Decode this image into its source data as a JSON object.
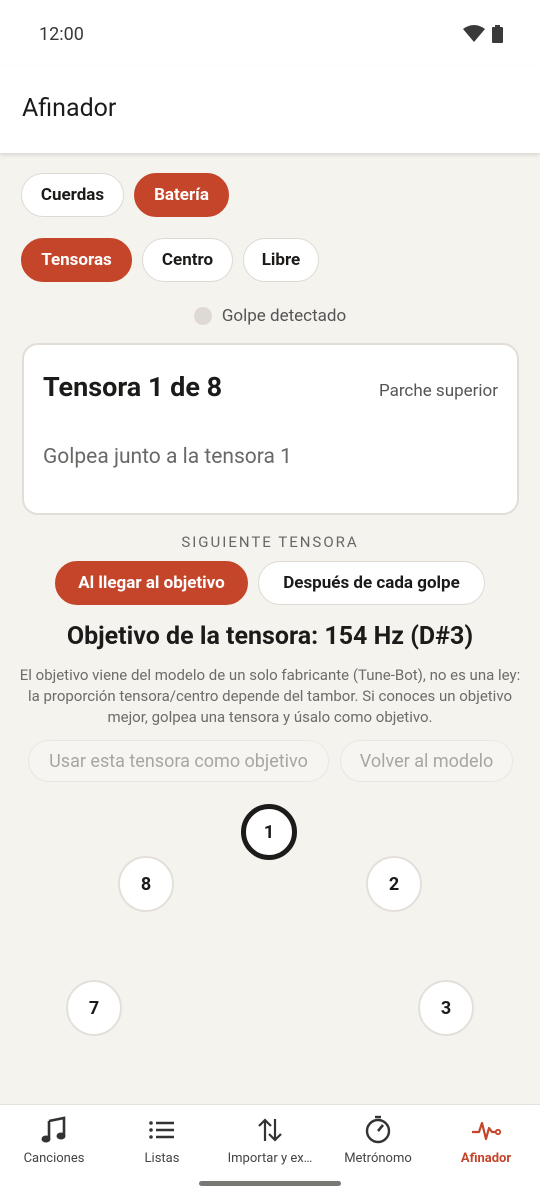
{
  "status": {
    "time": "12:00"
  },
  "app_bar": {
    "title": "Afinador"
  },
  "instrument_tabs": [
    {
      "label": "Cuerdas",
      "active": false
    },
    {
      "label": "Batería",
      "active": true
    }
  ],
  "mode_tabs": [
    {
      "label": "Tensoras",
      "active": true
    },
    {
      "label": "Centro",
      "active": false
    },
    {
      "label": "Libre",
      "active": false
    }
  ],
  "hit_indicator": {
    "label": "Golpe detectado"
  },
  "card": {
    "title": "Tensora 1 de 8",
    "head": "Parche superior",
    "instruction": "Golpea junto a la tensora 1"
  },
  "next_lug": {
    "label": "SIGUIENTE TENSORA",
    "options": [
      {
        "label": "Al llegar al objetivo",
        "active": true
      },
      {
        "label": "Después de cada golpe",
        "active": false
      }
    ]
  },
  "target": {
    "heading": "Objetivo de la tensora: 154 Hz (D#3)",
    "note": "El objetivo viene del modelo de un solo fabricante (Tune-Bot), no es una ley: la proporción tensora/centro depende del tambor. Si conoces un objetivo mejor, golpea una tensora y úsalo como objetivo."
  },
  "actions": {
    "use_as_target": "Usar esta tensora como objetivo",
    "back_to_model": "Volver al modelo"
  },
  "lugs": [
    {
      "number": "1",
      "current": true
    },
    {
      "number": "2",
      "current": false
    },
    {
      "number": "3",
      "current": false
    },
    {
      "number": "7",
      "current": false
    },
    {
      "number": "8",
      "current": false
    }
  ],
  "nav": [
    {
      "label": "Canciones",
      "icon": "music-note-icon",
      "active": false
    },
    {
      "label": "Listas",
      "icon": "list-icon",
      "active": false
    },
    {
      "label": "Importar y ex…",
      "icon": "import-export-icon",
      "active": false
    },
    {
      "label": "Metrónomo",
      "icon": "timer-icon",
      "active": false
    },
    {
      "label": "Afinador",
      "icon": "pulse-icon",
      "active": true
    }
  ],
  "colors": {
    "accent": "#c4452a",
    "background": "#f5f3ee",
    "surface": "#ffffff"
  }
}
